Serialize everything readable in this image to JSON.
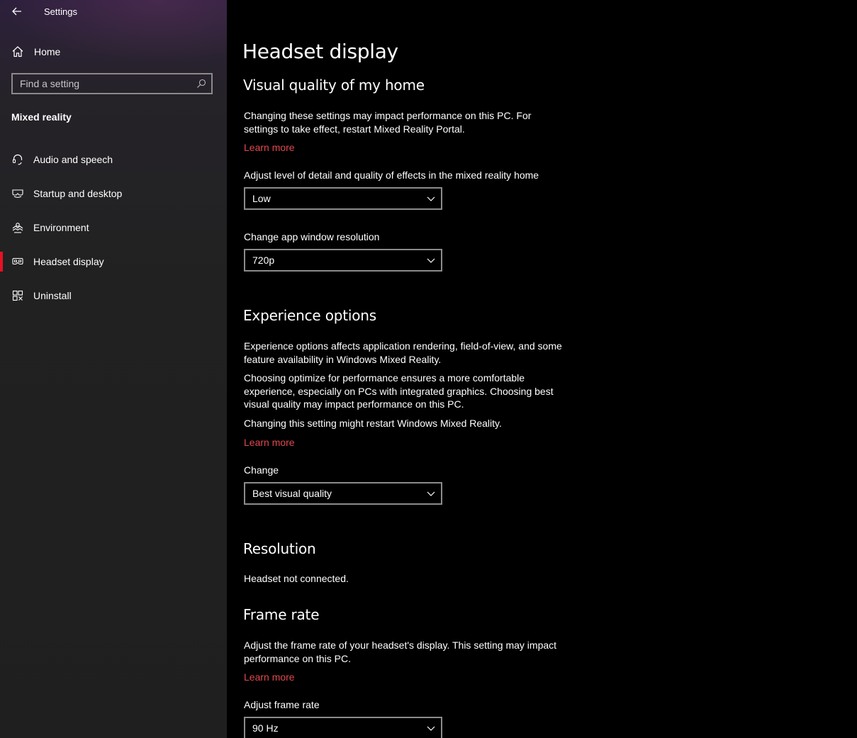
{
  "window": {
    "title": "Settings"
  },
  "sidebar": {
    "home_label": "Home",
    "search_placeholder": "Find a setting",
    "section_label": "Mixed reality",
    "items": [
      {
        "label": "Audio and speech",
        "icon": "headset-mic-icon"
      },
      {
        "label": "Startup and desktop",
        "icon": "headset-icon"
      },
      {
        "label": "Environment",
        "icon": "environment-icon"
      },
      {
        "label": "Headset display",
        "icon": "headset-display-icon",
        "active": true
      },
      {
        "label": "Uninstall",
        "icon": "uninstall-icon"
      }
    ],
    "accent_color": "#e81123"
  },
  "main": {
    "title": "Headset display",
    "visual_quality": {
      "heading": "Visual quality of my home",
      "description": "Changing these settings may impact performance on this PC. For settings to take effect, restart Mixed Reality Portal.",
      "learn_more": "Learn more",
      "detail_label": "Adjust level of detail and quality of effects in the mixed reality home",
      "detail_value": "Low",
      "resolution_label": "Change app window resolution",
      "resolution_value": "720p"
    },
    "experience": {
      "heading": "Experience options",
      "desc1": "Experience options affects application rendering, field-of-view, and some feature availability in Windows Mixed Reality.",
      "desc2": "Choosing optimize for performance ensures a more comfortable experience, especially on PCs with integrated graphics. Choosing best visual quality may impact performance on this PC.",
      "desc3": "Changing this setting might restart Windows Mixed Reality.",
      "learn_more": "Learn more",
      "change_label": "Change",
      "change_value": "Best visual quality"
    },
    "resolution": {
      "heading": "Resolution",
      "status": "Headset not connected."
    },
    "frame_rate": {
      "heading": "Frame rate",
      "description": "Adjust the frame rate of your headset's display. This setting may impact performance on this PC.",
      "learn_more": "Learn more",
      "adjust_label": "Adjust frame rate",
      "adjust_value": "90 Hz"
    },
    "link_color": "#e0494f"
  }
}
